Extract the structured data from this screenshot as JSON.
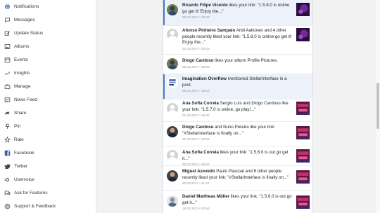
{
  "sidebar": {
    "items": [
      {
        "label": "Notifications",
        "icon": "globe-icon"
      },
      {
        "label": "Messages",
        "icon": "chat-icon"
      },
      {
        "label": "Update Status",
        "icon": "edit-icon"
      },
      {
        "label": "Albums",
        "icon": "image-icon"
      },
      {
        "label": "Events",
        "icon": "calendar-icon"
      },
      {
        "label": "Insights",
        "icon": "trend-icon"
      },
      {
        "label": "Manage",
        "icon": "briefcase-icon"
      },
      {
        "label": "News Feed",
        "icon": "newspaper-icon"
      },
      {
        "label": "Share",
        "icon": "share-icon"
      },
      {
        "label": "Pin",
        "icon": "pin-icon"
      },
      {
        "label": "Rate",
        "icon": "star-icon"
      },
      {
        "label": "Facebook",
        "icon": "facebook-icon"
      },
      {
        "label": "Twitter",
        "icon": "twitter-icon"
      },
      {
        "label": "Uservoice",
        "icon": "megaphone-icon"
      },
      {
        "label": "Ask for Features",
        "icon": "chat-bubble-icon"
      },
      {
        "label": "Support & Feedback",
        "icon": "lifebuoy-icon"
      }
    ]
  },
  "colors": {
    "accent": "#4a76c6",
    "unread_bg": "#edf2fa",
    "feed_bg": "#f2f2f2",
    "time_text": "#90949c"
  },
  "notifications": [
    {
      "name": "Ricardo Filipe Vicente",
      "text": " likes your link: \"1.5.8.0 is online go get it! Enjoy the...\"",
      "time": "22.04.2017 • 23:43",
      "unread": true,
      "thumbnail": "purple"
    },
    {
      "name": "Afonso Pinheiro Sampaio",
      "text": "  Antti Aaltonen and 4 other people recently liked your link: \"1.5.8.0 is online go get it! Enjoy the...\"",
      "time": "22.04.2017 • 20:22",
      "unread": false,
      "thumbnail": "purple"
    },
    {
      "name": "Diogo Cardoso",
      "text": " likes your album Profile Pictures.",
      "time": "06.04.2017 • 16:29",
      "unread": false,
      "thumbnail": ""
    },
    {
      "name": "Imagination Overflow",
      "text": " mentioned StellarInterface in a post.",
      "time": "06.04.2017 • 16:23",
      "unread": true,
      "thumbnail": ""
    },
    {
      "name": "Ana Sofia Correia",
      "text": "  Sergio Luis and Diogo Cardoso like your link: \"1.5.7.0 is online, go play!...\"",
      "time": "01.04.2017 • 10:46",
      "unread": false,
      "thumbnail": "pink"
    },
    {
      "name": "Diogo Cardoso",
      "text": " and Nuno Pereira like your link: \"#StellarInterface is finally on...\"",
      "time": "31.03.2017 • 22:04",
      "unread": false,
      "thumbnail": "pink"
    },
    {
      "name": "Ana Sofia Correia",
      "text": " likes your link: \"1.5.6.0 is out go get it...\"",
      "time": "20.03.2017 • 15:04",
      "unread": false,
      "thumbnail": "pink"
    },
    {
      "name": "Miguel Azevedo",
      "text": "  Paulo Pascoal and 6 other people recently liked your link: \"#StellarInterface is finally on...\"",
      "time": "20.03.2017 • 11:42",
      "unread": false,
      "thumbnail": "pink"
    },
    {
      "name": "Daniel Mattheas Müller",
      "text": " likes your link: \"1.5.6.0 is out go get it...\"",
      "time": "19.03.2017 • 20:54",
      "unread": false,
      "thumbnail": "pink"
    }
  ]
}
